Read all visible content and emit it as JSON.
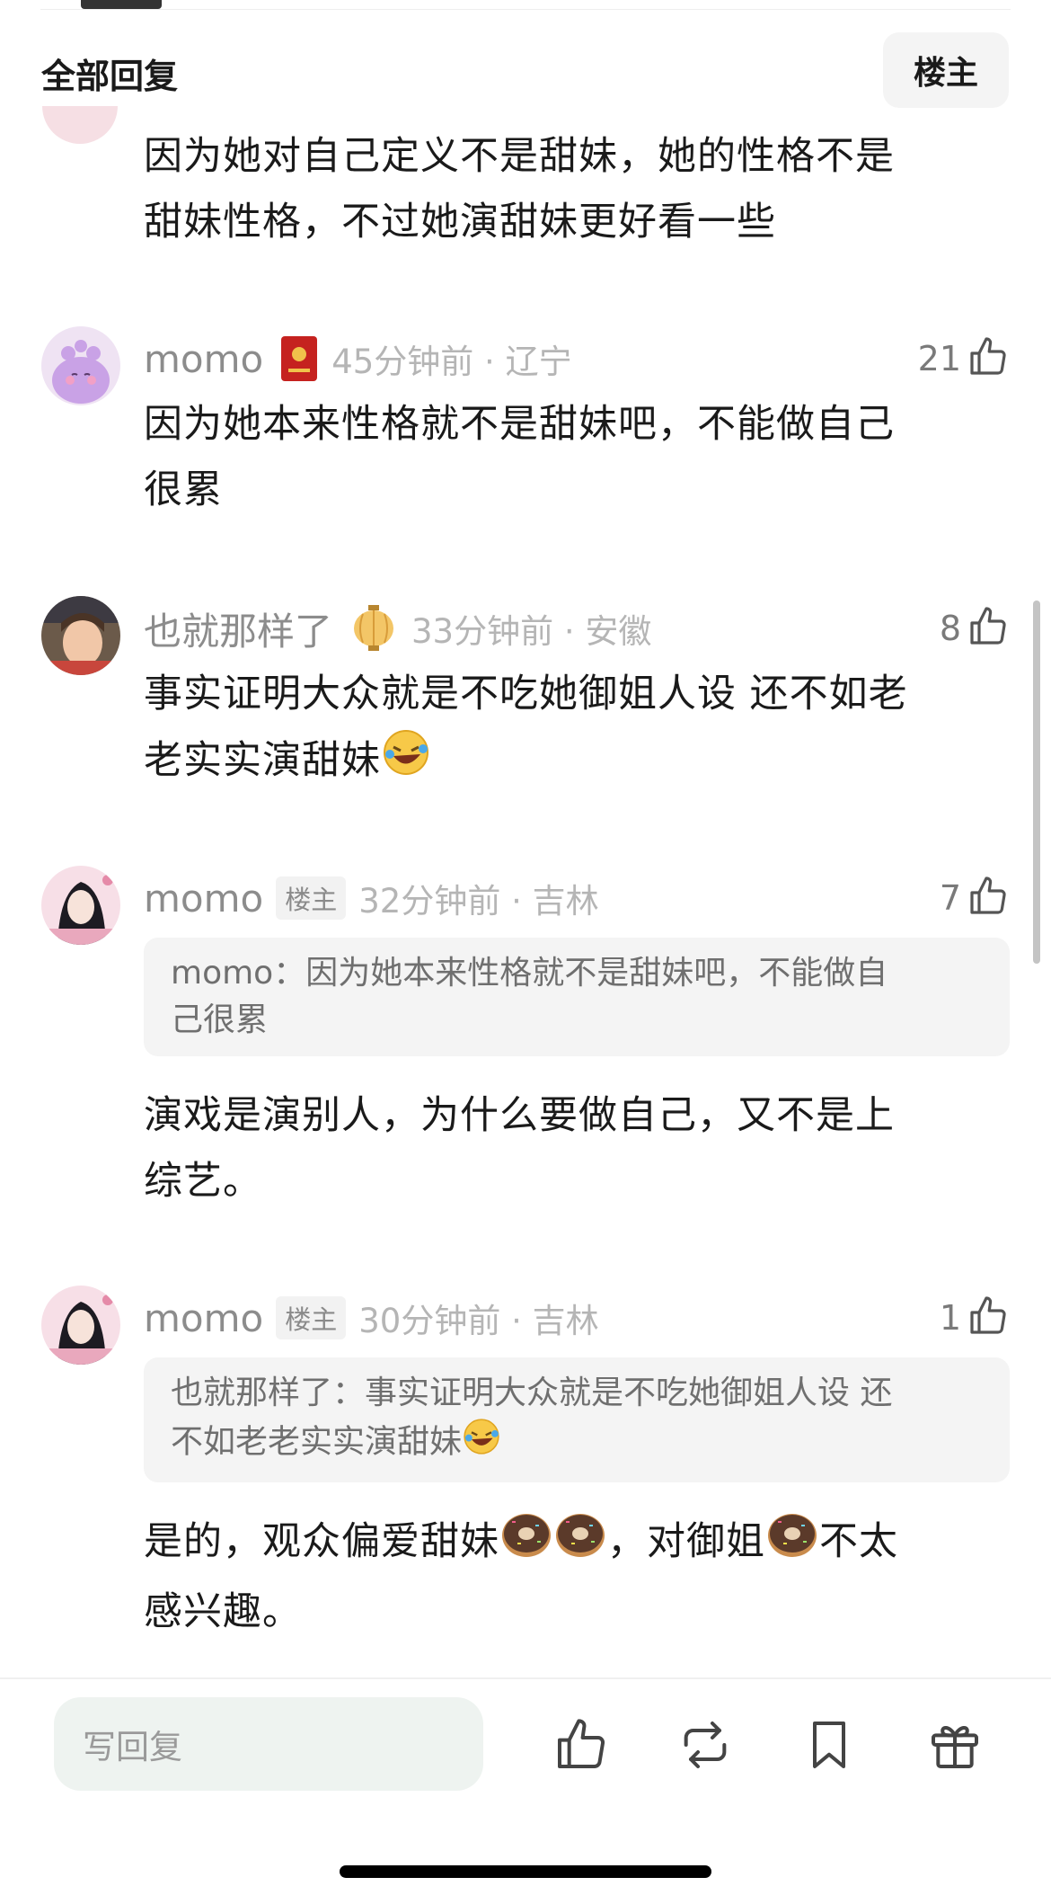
{
  "header": {
    "title": "全部回复",
    "filter_button": "楼主"
  },
  "first_comment": {
    "lines": [
      "因为她对自己定义不是甜妹，她的性格不是",
      "甜妹性格，不过她演甜妹更好看一些"
    ]
  },
  "comments": [
    {
      "username": "momo",
      "badge": "red-envelope-badge-icon",
      "time_location": "45分钟前 · 辽宁",
      "likes": "21",
      "lines": [
        "因为她本来性格就不是甜妹吧，不能做自己",
        "很累"
      ]
    },
    {
      "username": "也就那样了",
      "badge": "lantern-badge-icon",
      "time_location": "33分钟前 · 安徽",
      "likes": "8",
      "lines": [
        "事实证明大众就是不吃她御姐人设 还不如老",
        "老实实演甜妹"
      ]
    },
    {
      "username": "momo",
      "tag": "楼主",
      "time_location": "32分钟前 · 吉林",
      "likes": "7",
      "quote_lines": [
        "momo：因为她本来性格就不是甜妹吧，不能做自",
        "己很累"
      ],
      "lines": [
        "演戏是演别人，为什么要做自己，又不是上",
        "综艺。"
      ]
    },
    {
      "username": "momo",
      "tag": "楼主",
      "time_location": "30分钟前 · 吉林",
      "likes": "1",
      "quote_lines": [
        "也就那样了：事实证明大众就是不吃她御姐人设 还",
        "不如老老实实演甜妹"
      ],
      "line1_parts": [
        "是的，观众偏爱甜妹",
        "，对御姐",
        "不太"
      ],
      "line2": "感兴趣。"
    }
  ],
  "bottom_bar": {
    "reply_placeholder": "写回复",
    "icons": [
      "like-icon",
      "repost-icon",
      "bookmark-icon",
      "gift-icon"
    ]
  }
}
